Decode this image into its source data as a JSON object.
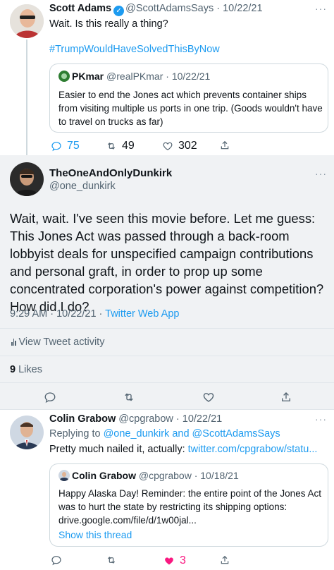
{
  "tweet1": {
    "name": "Scott Adams",
    "handle": "@ScottAdamsSays",
    "date": "· 10/22/21",
    "text": "Wait. Is this really a thing?",
    "hashtag": "#TrumpWouldHaveSolvedThisByNow",
    "quote": {
      "name": "PKmar",
      "handle": "@realPKmar",
      "date": "· 10/22/21",
      "text": "Easier to end the Jones act which prevents container ships from visiting multiple us ports in one trip. (Goods wouldn't have to travel on trucks as far)"
    },
    "replies": "75",
    "retweets": "49",
    "likes": "302"
  },
  "tweet2": {
    "name": "TheOneAndOnlyDunkirk",
    "handle": "@one_dunkirk",
    "text": "Wait, wait. I've seen this movie before. Let me guess: This Jones Act was passed through a back-room lobbyist deals for unspecified campaign contributions and personal graft, in order to prop up some concentrated corporation's power against competition? How did I do?",
    "time": "9:29 AM · 10/22/21 · ",
    "app": "Twitter Web App",
    "activity": "View Tweet activity",
    "likes_count": "9",
    "likes_label": " Likes"
  },
  "tweet3": {
    "name": "Colin Grabow",
    "handle": "@cpgrabow",
    "date": "· 10/22/21",
    "replying_prefix": "Replying to ",
    "replying_to": "@one_dunkirk and @ScottAdamsSays",
    "text": "Pretty much nailed it, actually: ",
    "link": "twitter.com/cpgrabow/statu...",
    "quote": {
      "name": "Colin Grabow",
      "handle": "@cpgrabow",
      "date": "· 10/18/21",
      "text": "Happy Alaska Day! Reminder: the entire point of the Jones Act was to hurt the state by restricting its shipping options: drive.google.com/file/d/1w00jal...",
      "show_thread": "Show this thread"
    },
    "likes": "3"
  },
  "more_glyph": "···",
  "colors": {
    "accent": "#1d9bf0",
    "like": "#f91880",
    "muted": "#536471",
    "selected_bg": "#f0f2f4"
  }
}
